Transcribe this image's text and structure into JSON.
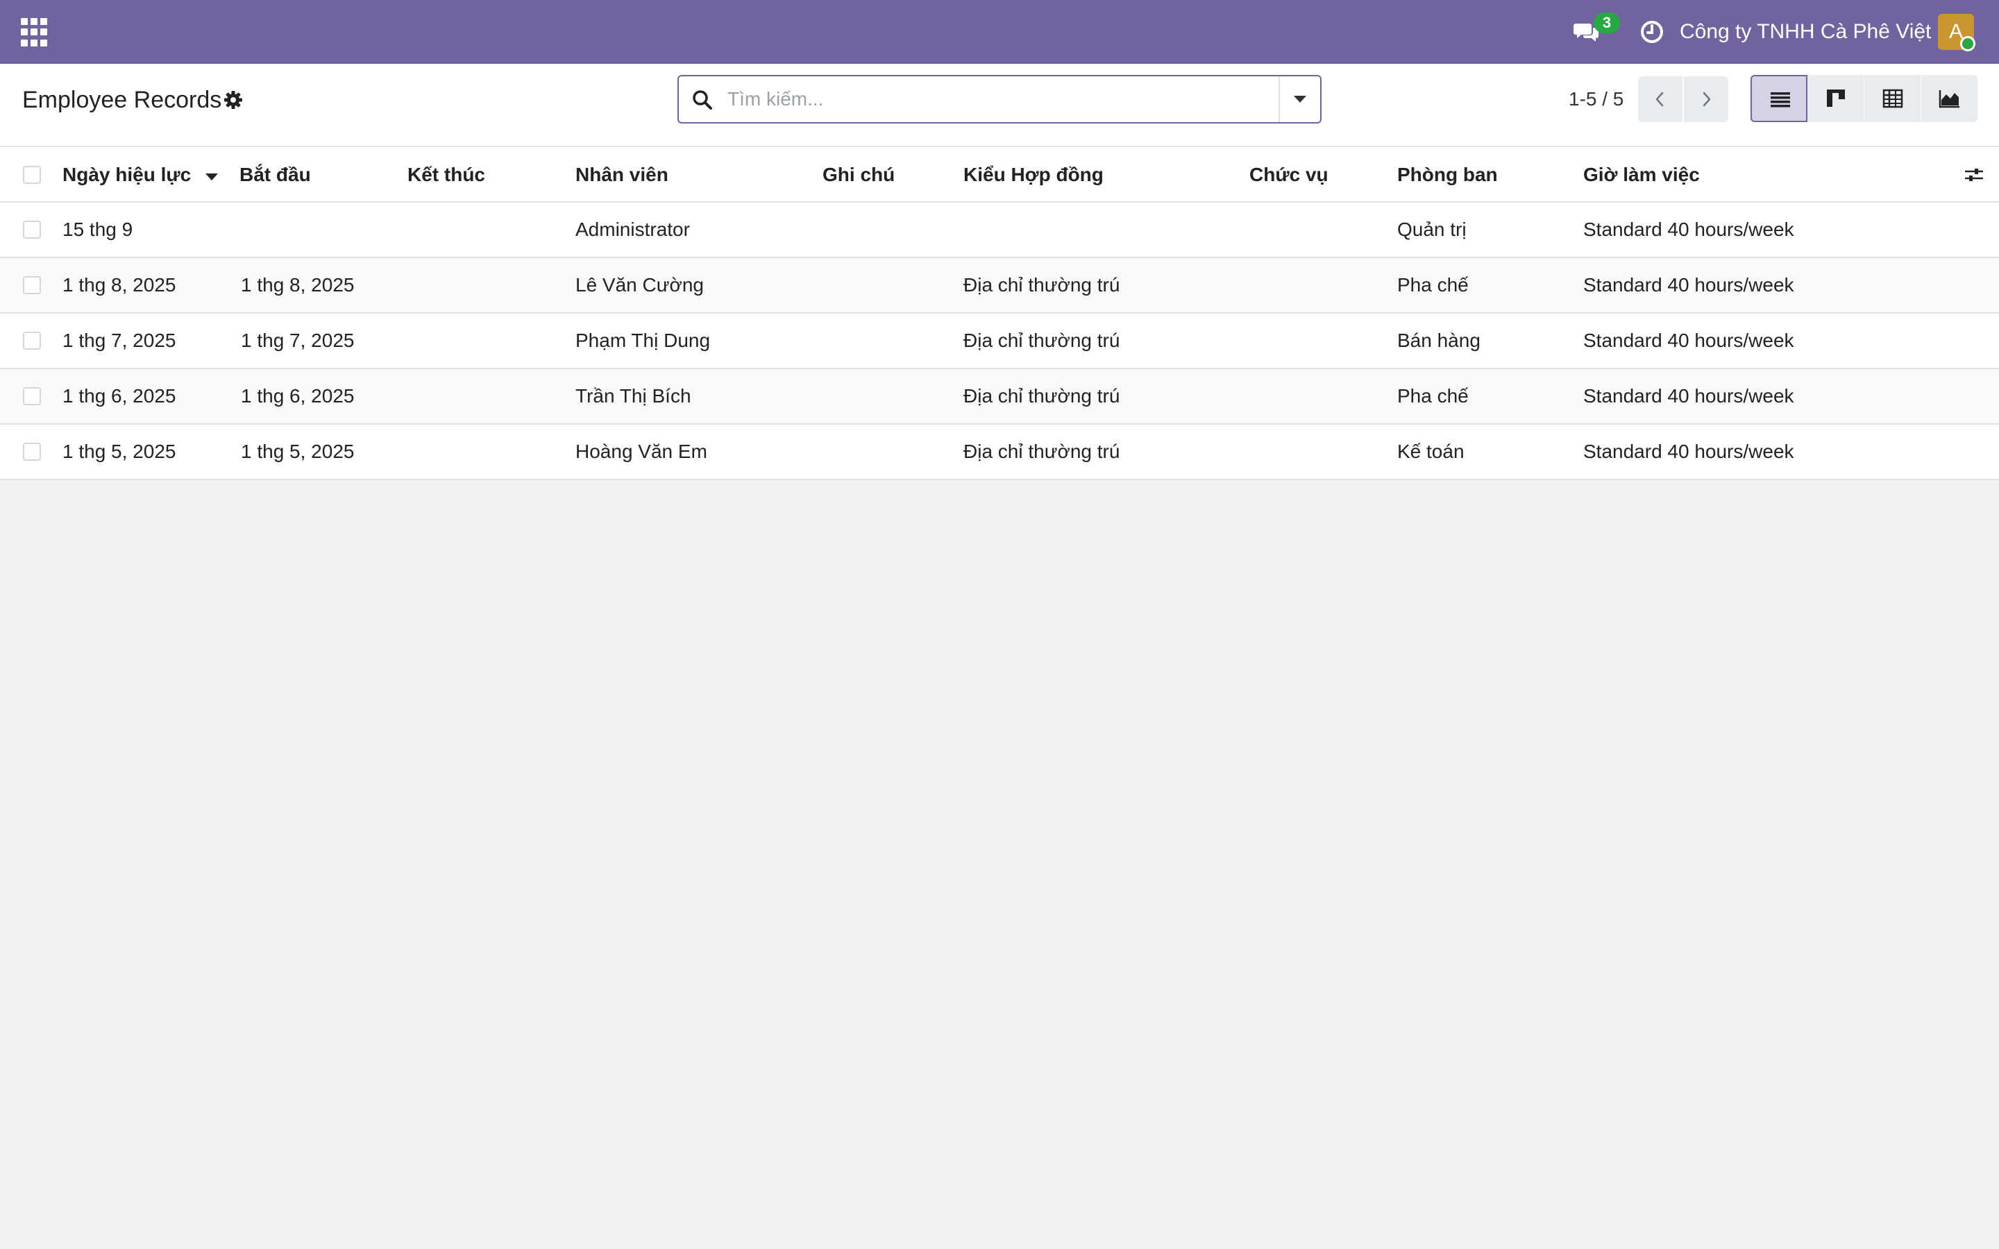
{
  "navbar": {
    "messages_count": "3",
    "company": "Công ty TNHH Cà Phê Việt",
    "avatar_letter": "A",
    "brand_color": "#71639e",
    "badge_color": "#28a745"
  },
  "control_panel": {
    "title": "Employee Records",
    "search_placeholder": "Tìm kiếm...",
    "pager": "1-5 / 5",
    "views": [
      "list-view-icon",
      "kanban-view-icon",
      "pivot-view-icon",
      "graph-view-icon"
    ]
  },
  "list": {
    "columns": {
      "date": "Ngày hiệu lực",
      "start": "Bắt đầu",
      "end": "Kết thúc",
      "employee": "Nhân viên",
      "note": "Ghi chú",
      "type": "Kiểu Hợp đồng",
      "job": "Chức vụ",
      "department": "Phòng ban",
      "hours": "Giờ làm việc"
    },
    "rows": [
      {
        "date": "15 thg 9",
        "start": "",
        "end": "",
        "employee": "Administrator",
        "note": "",
        "type": "",
        "job": "",
        "department": "Quản trị",
        "hours": "Standard 40 hours/week"
      },
      {
        "date": "1 thg 8, 2025",
        "start": "1 thg 8, 2025",
        "end": "",
        "employee": "Lê Văn Cường",
        "note": "",
        "type": "Địa chỉ thường trú",
        "job": "",
        "department": "Pha chế",
        "hours": "Standard 40 hours/week"
      },
      {
        "date": "1 thg 7, 2025",
        "start": "1 thg 7, 2025",
        "end": "",
        "employee": "Phạm Thị Dung",
        "note": "",
        "type": "Địa chỉ thường trú",
        "job": "",
        "department": "Bán hàng",
        "hours": "Standard 40 hours/week"
      },
      {
        "date": "1 thg 6, 2025",
        "start": "1 thg 6, 2025",
        "end": "",
        "employee": "Trần Thị Bích",
        "note": "",
        "type": "Địa chỉ thường trú",
        "job": "",
        "department": "Pha chế",
        "hours": "Standard 40 hours/week"
      },
      {
        "date": "1 thg 5, 2025",
        "start": "1 thg 5, 2025",
        "end": "",
        "employee": "Hoàng Văn Em",
        "note": "",
        "type": "Địa chỉ thường trú",
        "job": "",
        "department": "Kế toán",
        "hours": "Standard 40 hours/week"
      }
    ]
  }
}
